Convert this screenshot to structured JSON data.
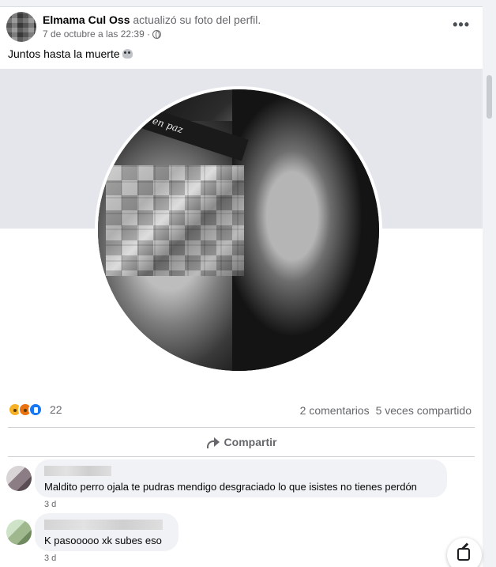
{
  "post": {
    "author": "Elmama Cul Oss",
    "action": "actualizó su foto del perfil.",
    "timestamp": "7 de octubre a las 22:39 ·",
    "privacy_icon": "globe-icon",
    "more_label": "•••",
    "text": "Juntos hasta la muerte",
    "text_emoji": "skull-icon",
    "photo_band_text": "sa en paz"
  },
  "stats": {
    "reaction_icons": [
      "wow-reaction-icon",
      "angry-reaction-icon",
      "like-reaction-icon"
    ],
    "reaction_count": "22",
    "comments": "2 comentarios",
    "shares": "5 veces compartido"
  },
  "actions": {
    "share_label": "Compartir",
    "share_icon": "share-arrow-icon"
  },
  "comments": [
    {
      "text": "Maldito perro ojala te pudras mendigo desgraciado lo que isistes no tienes perdón",
      "time": "3 d"
    },
    {
      "text": "K pasooooo xk subes eso",
      "time": "3 d"
    }
  ],
  "colors": {
    "page_bg": "#f0f2f5",
    "card_bg": "#ffffff",
    "secondary_text": "#65676b",
    "like_blue": "#1877f2"
  }
}
